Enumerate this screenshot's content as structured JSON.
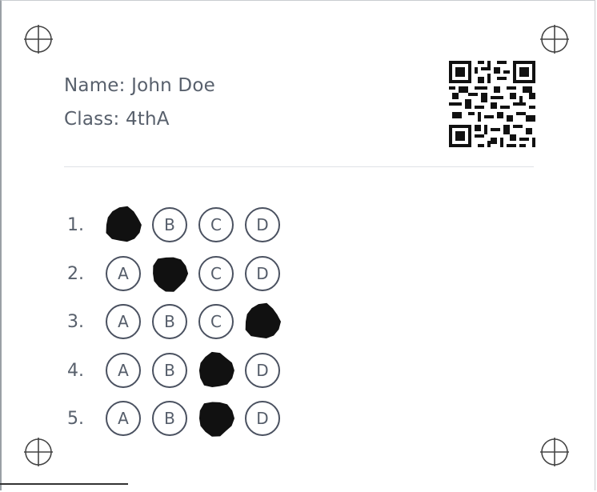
{
  "student": {
    "name_line": "Name: John Doe",
    "class_line": "Class: 4thA"
  },
  "questions": [
    {
      "number": "1.",
      "options": [
        "A",
        "B",
        "C",
        "D"
      ],
      "marked": "A"
    },
    {
      "number": "2.",
      "options": [
        "A",
        "B",
        "C",
        "D"
      ],
      "marked": "B"
    },
    {
      "number": "3.",
      "options": [
        "A",
        "B",
        "C",
        "D"
      ],
      "marked": "D"
    },
    {
      "number": "4.",
      "options": [
        "A",
        "B",
        "C",
        "D"
      ],
      "marked": "C"
    },
    {
      "number": "5.",
      "options": [
        "A",
        "B",
        "C",
        "D"
      ],
      "marked": "C"
    }
  ],
  "icons": {
    "registration_marks": "crosshair-icon",
    "qr": "qr-code-icon"
  },
  "colors": {
    "ink": "#111111",
    "text": "#58606c",
    "bubble_border": "#4a5160",
    "divider": "#dfe2e6"
  }
}
